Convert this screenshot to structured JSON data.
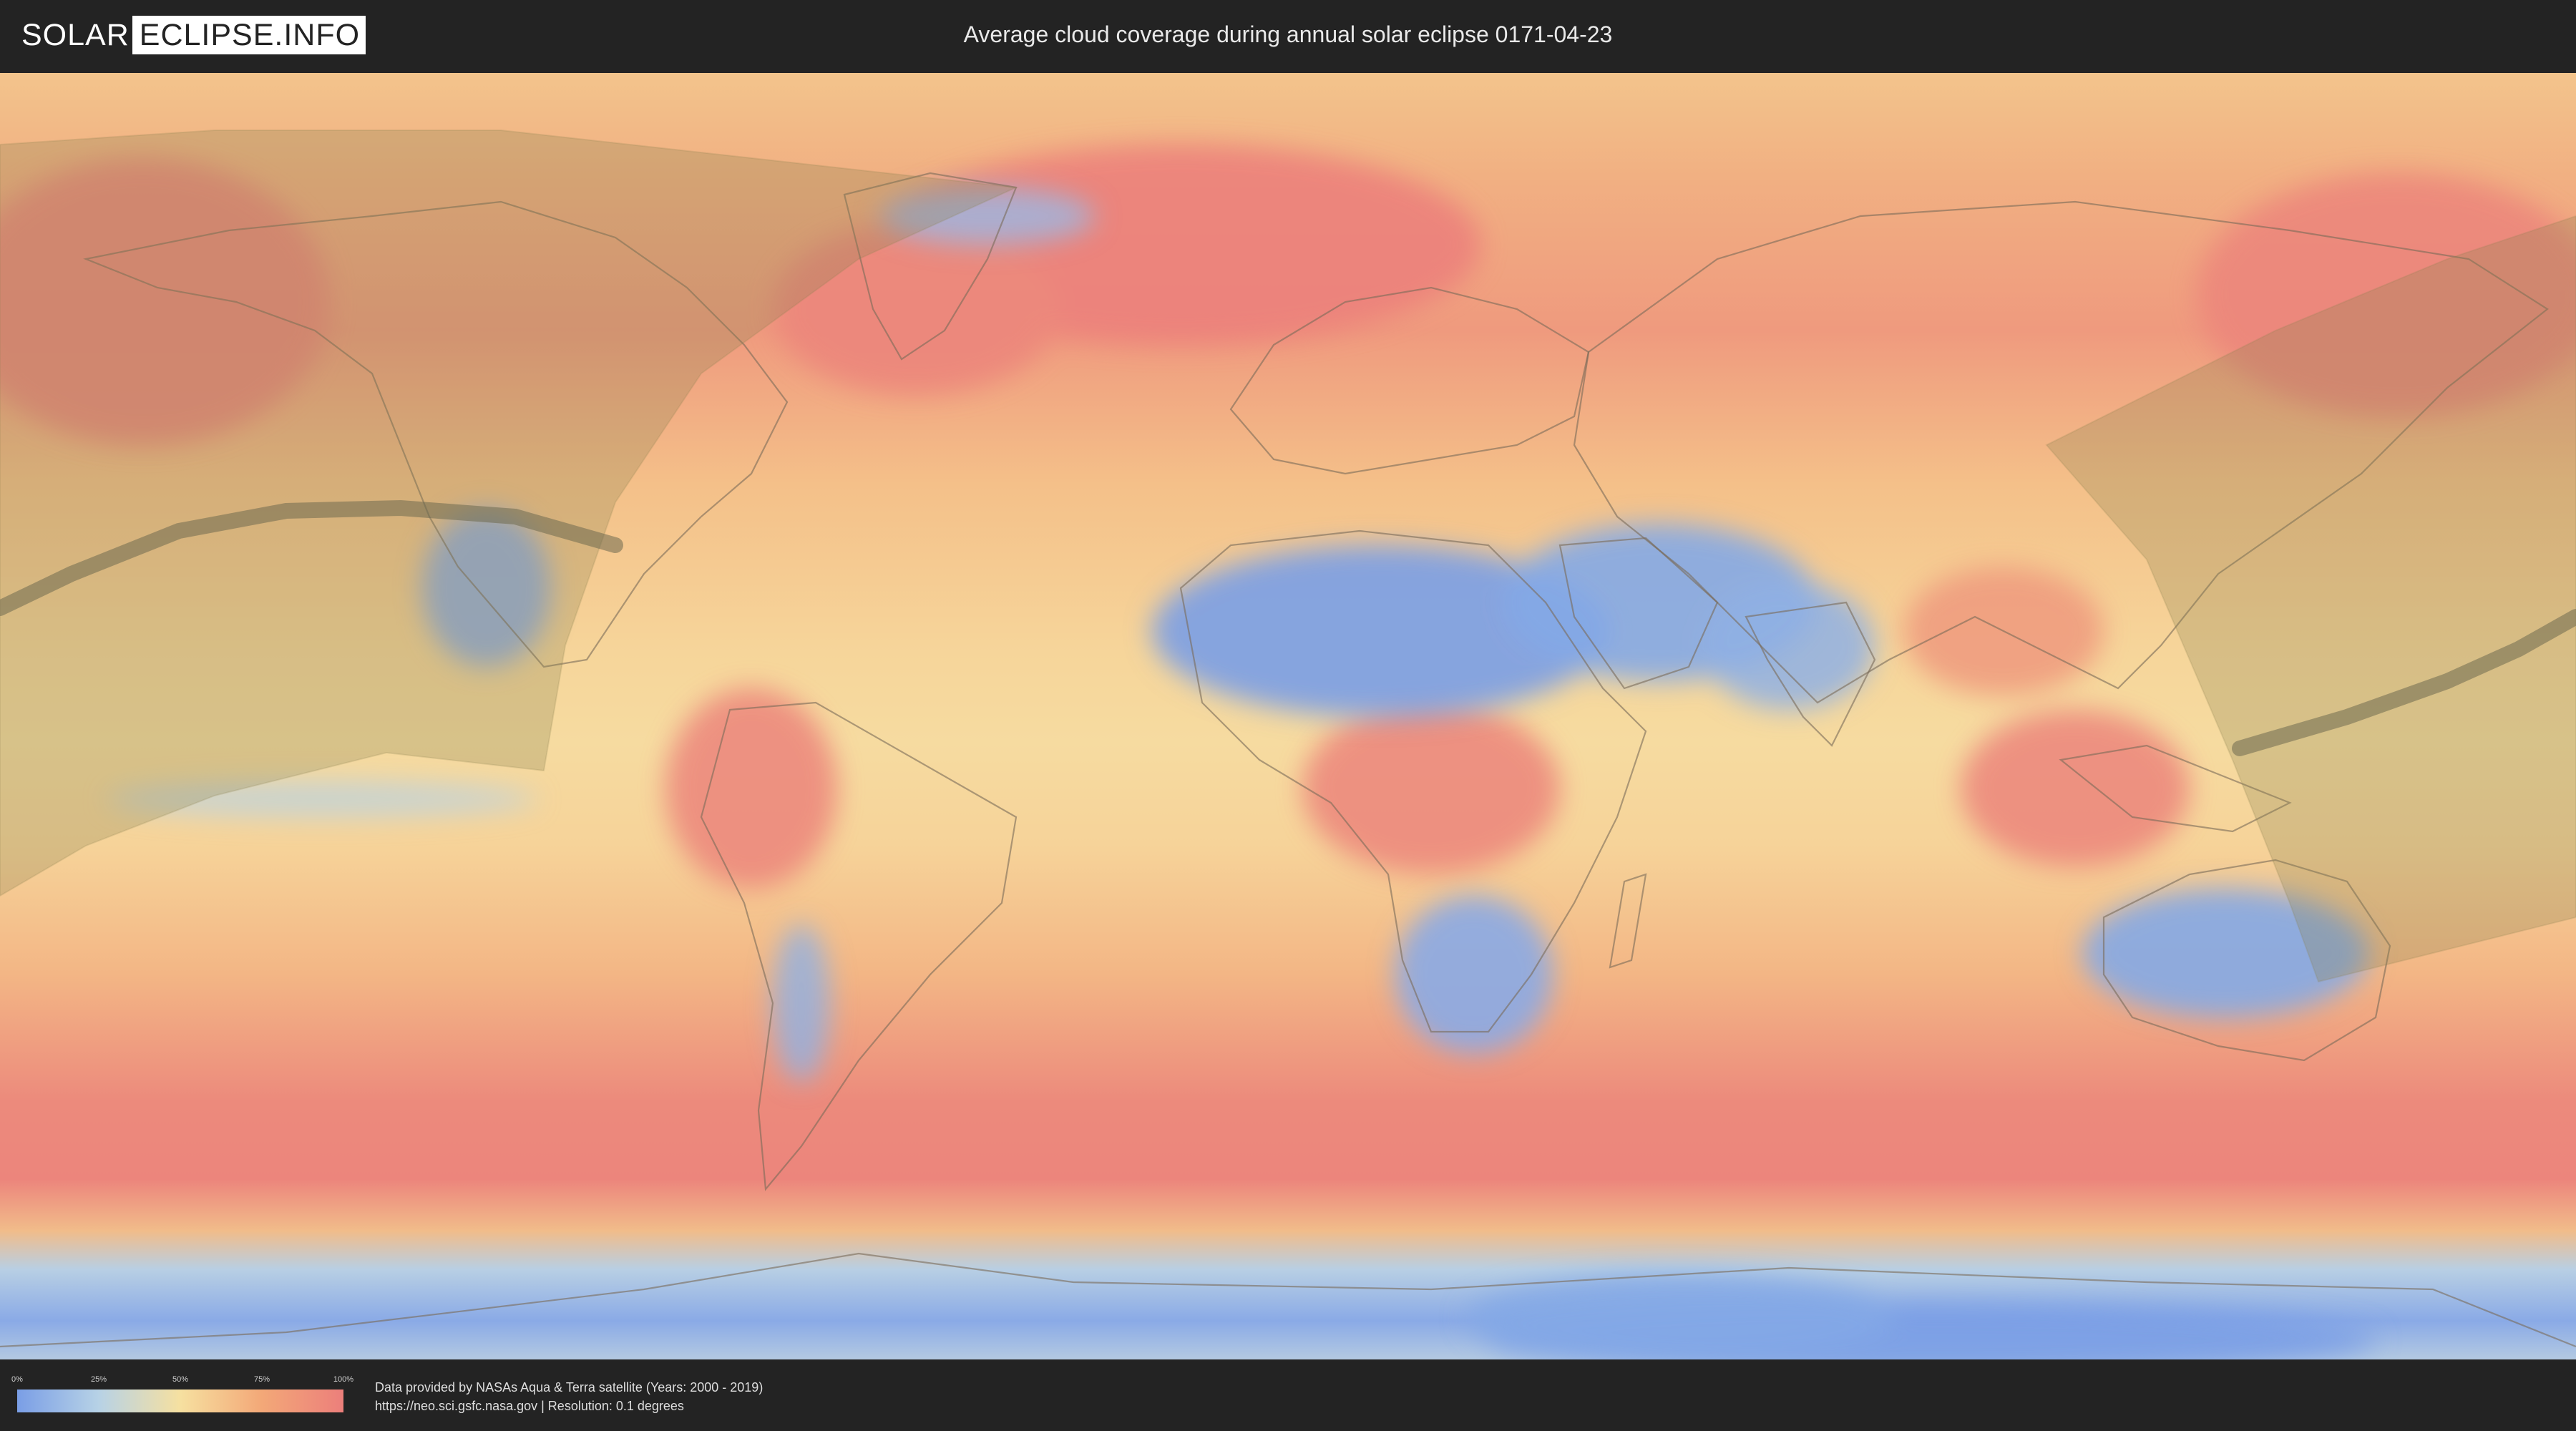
{
  "header": {
    "logo_left": "SOLAR",
    "logo_right": "ECLIPSE.INFO",
    "title": "Average cloud coverage during annual solar eclipse 0171-04-23"
  },
  "map": {
    "description_icon": "world-map-icon",
    "colors": {
      "clear": "#7a9ee6",
      "low": "#b7d2e6",
      "mid": "#f6e0a0",
      "high": "#f3a878",
      "full": "#ec7f7b",
      "shadow_overlay": "#8a8050",
      "central_path": "#6e6a50"
    }
  },
  "legend": {
    "ticks": [
      "0%",
      "25%",
      "50%",
      "75%",
      "100%"
    ],
    "tick_values": [
      0,
      25,
      50,
      75,
      100
    ]
  },
  "footer": {
    "credit_line1": "Data provided by NASAs Aqua & Terra satellite (Years: 2000 - 2019)",
    "credit_line2": "https://neo.sci.gsfc.nasa.gov | Resolution: 0.1 degrees"
  }
}
